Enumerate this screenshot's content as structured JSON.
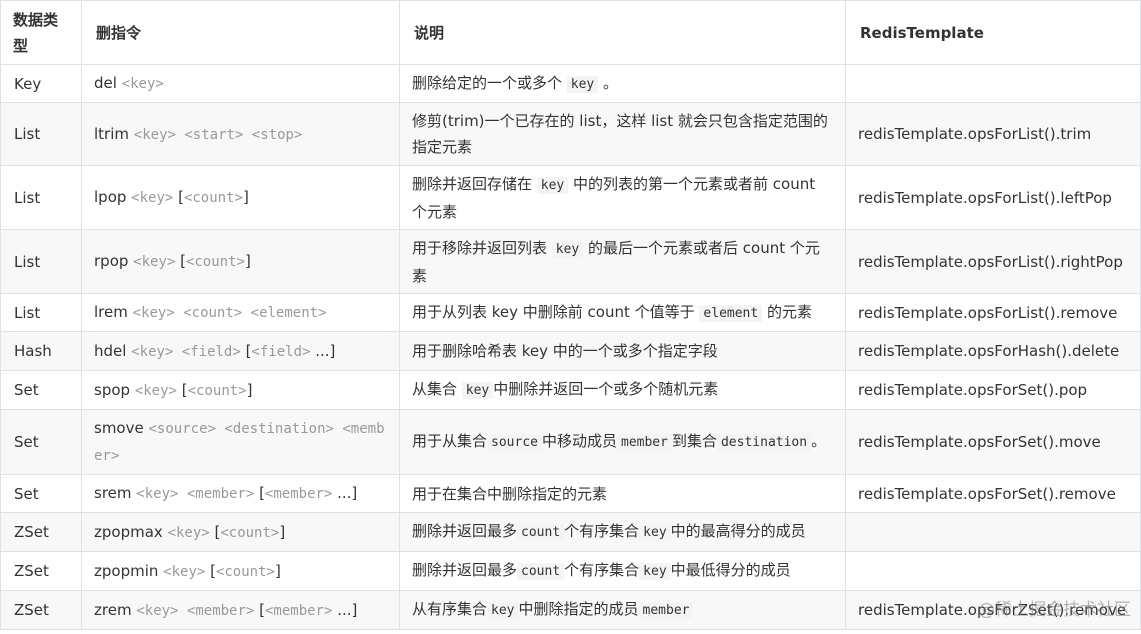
{
  "headers": [
    "数据类型",
    "删指令",
    "说明",
    "RedisTemplate"
  ],
  "rows": [
    {
      "type": "Key",
      "cmd": [
        {
          "t": "del",
          "s": "p"
        },
        {
          "t": " ",
          "s": "p"
        },
        {
          "t": "<key>",
          "s": "m"
        }
      ],
      "desc": [
        {
          "t": "删除给定的一个或多个 ",
          "s": "p"
        },
        {
          "t": "key",
          "s": "k"
        },
        {
          "t": " 。",
          "s": "p"
        }
      ],
      "tmpl": ""
    },
    {
      "type": "List",
      "cmd": [
        {
          "t": "ltrim",
          "s": "p"
        },
        {
          "t": " ",
          "s": "p"
        },
        {
          "t": "<key> <start> <stop>",
          "s": "m"
        }
      ],
      "desc": [
        {
          "t": "修剪(trim)一个已存在的 list，这样 list 就会只包含指定范围的指定元素",
          "s": "p"
        }
      ],
      "tmpl": "redisTemplate.opsForList().trim"
    },
    {
      "type": "List",
      "cmd": [
        {
          "t": "lpop",
          "s": "p"
        },
        {
          "t": " ",
          "s": "p"
        },
        {
          "t": "<key>",
          "s": "m"
        },
        {
          "t": " [",
          "s": "p"
        },
        {
          "t": "<count>",
          "s": "m"
        },
        {
          "t": "]",
          "s": "p"
        }
      ],
      "desc": [
        {
          "t": "删除并返回存储在 ",
          "s": "p"
        },
        {
          "t": "key",
          "s": "k"
        },
        {
          "t": " 中的列表的第一个元素或者前 count 个元素",
          "s": "p"
        }
      ],
      "tmpl": "redisTemplate.opsForList().leftPop"
    },
    {
      "type": "List",
      "cmd": [
        {
          "t": "rpop",
          "s": "p"
        },
        {
          "t": " ",
          "s": "p"
        },
        {
          "t": "<key>",
          "s": "m"
        },
        {
          "t": " [",
          "s": "p"
        },
        {
          "t": "<count>",
          "s": "m"
        },
        {
          "t": "]",
          "s": "p"
        }
      ],
      "desc": [
        {
          "t": "用于移除并返回列表 ",
          "s": "p"
        },
        {
          "t": "key",
          "s": "k"
        },
        {
          "t": " 的最后一个元素或者后 count 个元素",
          "s": "p"
        }
      ],
      "tmpl": "redisTemplate.opsForList().rightPop"
    },
    {
      "type": "List",
      "cmd": [
        {
          "t": "lrem",
          "s": "p"
        },
        {
          "t": " ",
          "s": "p"
        },
        {
          "t": "<key> <count> <element>",
          "s": "m"
        }
      ],
      "desc": [
        {
          "t": "用于从列表 key 中删除前 count 个值等于 ",
          "s": "p"
        },
        {
          "t": "element",
          "s": "k"
        },
        {
          "t": " 的元素",
          "s": "p"
        }
      ],
      "tmpl": "redisTemplate.opsForList().remove"
    },
    {
      "type": "Hash",
      "cmd": [
        {
          "t": "hdel",
          "s": "p"
        },
        {
          "t": " ",
          "s": "p"
        },
        {
          "t": "<key> <field>",
          "s": "m"
        },
        {
          "t": " [",
          "s": "p"
        },
        {
          "t": "<field>",
          "s": "m"
        },
        {
          "t": " ...]",
          "s": "p"
        }
      ],
      "desc": [
        {
          "t": "用于删除哈希表 key 中的一个或多个指定字段",
          "s": "p"
        }
      ],
      "tmpl": "redisTemplate.opsForHash().delete"
    },
    {
      "type": "Set",
      "cmd": [
        {
          "t": "spop",
          "s": "p"
        },
        {
          "t": " ",
          "s": "p"
        },
        {
          "t": "<key>",
          "s": "m"
        },
        {
          "t": " [",
          "s": "p"
        },
        {
          "t": "<count>",
          "s": "m"
        },
        {
          "t": "]",
          "s": "p"
        }
      ],
      "desc": [
        {
          "t": "从集合 ",
          "s": "p"
        },
        {
          "t": "key",
          "s": "k"
        },
        {
          "t": "中删除并返回一个或多个随机元素",
          "s": "p"
        }
      ],
      "tmpl": "redisTemplate.opsForSet().pop"
    },
    {
      "type": "Set",
      "cmd": [
        {
          "t": "smove",
          "s": "p"
        },
        {
          "t": " ",
          "s": "p"
        },
        {
          "t": "<source> <destination> <member>",
          "s": "m"
        }
      ],
      "desc": [
        {
          "t": "用于从集合",
          "s": "p"
        },
        {
          "t": "source",
          "s": "k"
        },
        {
          "t": "中移动成员",
          "s": "p"
        },
        {
          "t": "member",
          "s": "k"
        },
        {
          "t": "到集合",
          "s": "p"
        },
        {
          "t": "destination",
          "s": "k"
        },
        {
          "t": "。",
          "s": "p"
        }
      ],
      "tmpl": "redisTemplate.opsForSet().move"
    },
    {
      "type": "Set",
      "cmd": [
        {
          "t": "srem",
          "s": "p"
        },
        {
          "t": " ",
          "s": "p"
        },
        {
          "t": "<key> <member>",
          "s": "m"
        },
        {
          "t": " [",
          "s": "p"
        },
        {
          "t": "<member>",
          "s": "m"
        },
        {
          "t": " ...]",
          "s": "p"
        }
      ],
      "desc": [
        {
          "t": "用于在集合中删除指定的元素",
          "s": "p"
        }
      ],
      "tmpl": "redisTemplate.opsForSet().remove"
    },
    {
      "type": "ZSet",
      "cmd": [
        {
          "t": "zpopmax",
          "s": "p"
        },
        {
          "t": " ",
          "s": "p"
        },
        {
          "t": "<key>",
          "s": "m"
        },
        {
          "t": " [",
          "s": "p"
        },
        {
          "t": "<count>",
          "s": "m"
        },
        {
          "t": "]",
          "s": "p"
        }
      ],
      "desc": [
        {
          "t": "删除并返回最多",
          "s": "p"
        },
        {
          "t": "count",
          "s": "k"
        },
        {
          "t": "个有序集合",
          "s": "p"
        },
        {
          "t": "key",
          "s": "k"
        },
        {
          "t": "中的最高得分的成员",
          "s": "p"
        }
      ],
      "tmpl": ""
    },
    {
      "type": "ZSet",
      "cmd": [
        {
          "t": "zpopmin",
          "s": "p"
        },
        {
          "t": " ",
          "s": "p"
        },
        {
          "t": "<key>",
          "s": "m"
        },
        {
          "t": " [",
          "s": "p"
        },
        {
          "t": "<count>",
          "s": "m"
        },
        {
          "t": "]",
          "s": "p"
        }
      ],
      "desc": [
        {
          "t": "删除并返回最多",
          "s": "p"
        },
        {
          "t": "count",
          "s": "k"
        },
        {
          "t": "个有序集合",
          "s": "p"
        },
        {
          "t": "key",
          "s": "k"
        },
        {
          "t": "中最低得分的成员",
          "s": "p"
        }
      ],
      "tmpl": ""
    },
    {
      "type": "ZSet",
      "cmd": [
        {
          "t": "zrem",
          "s": "p"
        },
        {
          "t": " ",
          "s": "p"
        },
        {
          "t": "<key> <member>",
          "s": "m"
        },
        {
          "t": " [",
          "s": "p"
        },
        {
          "t": "<member>",
          "s": "m"
        },
        {
          "t": " ...]",
          "s": "p"
        }
      ],
      "desc": [
        {
          "t": "从有序集合",
          "s": "p"
        },
        {
          "t": "key",
          "s": "k"
        },
        {
          "t": "中删除指定的成员",
          "s": "p"
        },
        {
          "t": "member",
          "s": "k"
        }
      ],
      "tmpl": "redisTemplate.opsForZSet().remove"
    }
  ],
  "watermark": "@稀土掘金技术社区"
}
